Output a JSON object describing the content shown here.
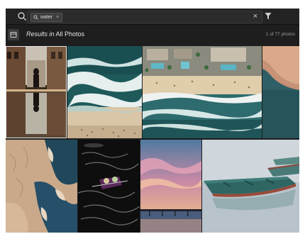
{
  "search": {
    "chip_label": "water",
    "chip_remove": "×",
    "clear": "×"
  },
  "results": {
    "prefix": "Results in",
    "scope": "All Photos",
    "count": "1 of 77 photos"
  },
  "photos": [
    {
      "subject": "person walking on wet street reflection"
    },
    {
      "subject": "aerial ocean waves on beach"
    },
    {
      "subject": "aerial beach resort with pools"
    },
    {
      "subject": "aerial shoreline cropped"
    },
    {
      "subject": "aerial sand patterns and water"
    },
    {
      "subject": "people in small boat on dark water"
    },
    {
      "subject": "pier at sunset pink clouds"
    },
    {
      "subject": "green rowboats on calm water"
    }
  ],
  "colors": {
    "app_bg": "#1e1e1e",
    "toolbar_bg": "#232323",
    "text": "#e6e6e6",
    "muted": "#9a9a9a"
  }
}
